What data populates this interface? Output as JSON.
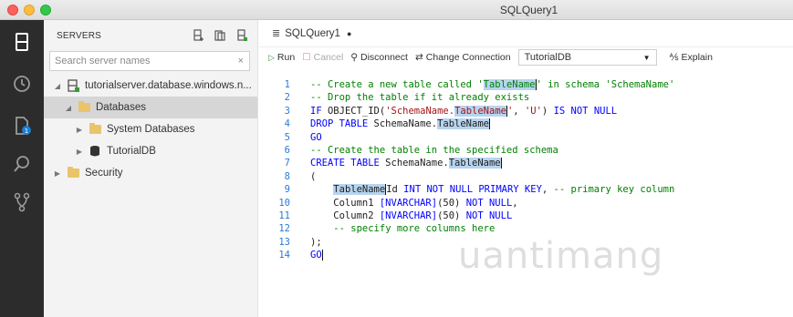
{
  "window": {
    "title": "SQLQuery1"
  },
  "sidebar": {
    "header": "SERVERS",
    "search_placeholder": "Search server names",
    "search_clear": "×",
    "tree": [
      {
        "label": "tutorialserver.database.windows.n...",
        "twisty": "◢",
        "icon": "server-icon"
      },
      {
        "label": "Databases",
        "twisty": "◢",
        "icon": "folder-icon",
        "selected": true
      },
      {
        "label": "System Databases",
        "twisty": "▶",
        "icon": "folder-icon"
      },
      {
        "label": "TutorialDB",
        "twisty": "▶",
        "icon": "database-icon"
      },
      {
        "label": "Security",
        "twisty": "▶",
        "icon": "folder-icon"
      }
    ]
  },
  "tab": {
    "label": "SQLQuery1",
    "dirty_marker": "●"
  },
  "toolbar": {
    "run": "Run",
    "cancel": "Cancel",
    "disconnect": "Disconnect",
    "change_connection": "Change Connection",
    "database": "TutorialDB",
    "explain": "Explain"
  },
  "code": {
    "line_numbers": [
      "1",
      "2",
      "3",
      "4",
      "5",
      "6",
      "7",
      "8",
      "9",
      "10",
      "11",
      "12",
      "13",
      "14"
    ]
  },
  "colors": {
    "activity_bar": "#2c2c2c",
    "sidebar": "#f3f3f3",
    "keyword": "#0000ff",
    "comment": "#008000",
    "string": "#a31515",
    "highlight": "#b7d4ef"
  },
  "watermark": "uantimang"
}
